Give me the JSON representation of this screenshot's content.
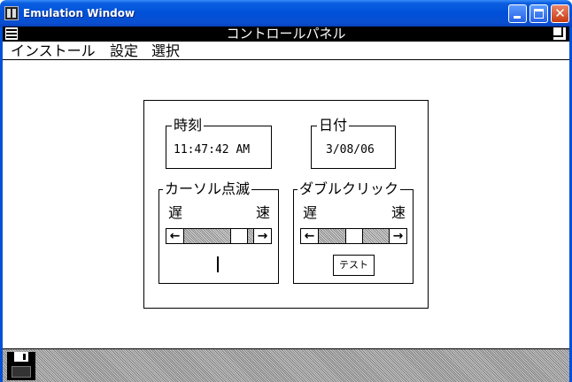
{
  "xp_window": {
    "title": "Emulation Window"
  },
  "win1_window": {
    "title": "コントロールパネル"
  },
  "menu": {
    "items": [
      "インストール",
      "設定",
      "選択"
    ]
  },
  "time_group": {
    "label": "時刻",
    "value": "11:47:42 AM"
  },
  "date_group": {
    "label": "日付",
    "value": "3/08/06"
  },
  "cursor_blink_group": {
    "label": "カーソル点滅",
    "slow_label": "遅",
    "fast_label": "速"
  },
  "double_click_group": {
    "label": "ダブルクリック",
    "slow_label": "遅",
    "fast_label": "速",
    "test_button_label": "テスト"
  },
  "icons": {
    "left_arrow": "←",
    "right_arrow": "→",
    "close": "✕"
  },
  "colors": {
    "xp_title_blue": "#0050d8",
    "xp_close_red": "#c93a10"
  }
}
